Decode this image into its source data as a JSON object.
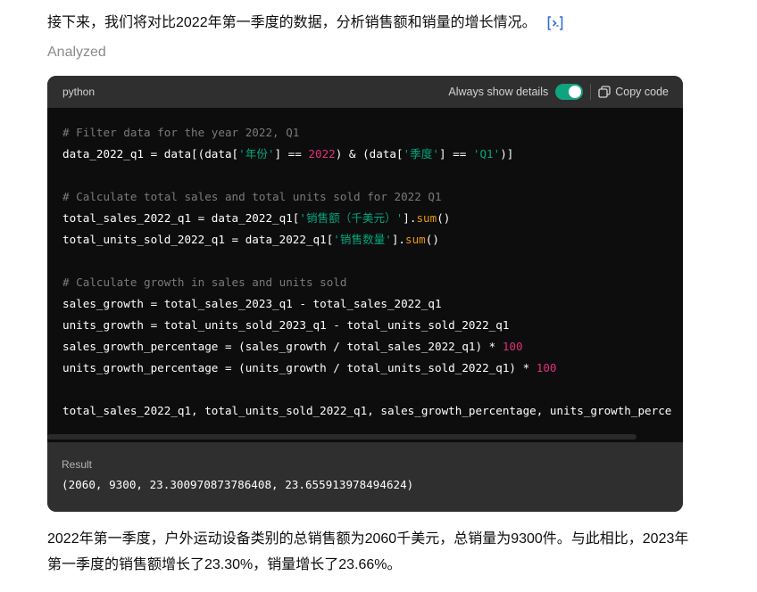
{
  "intro_text": "接下来，我们将对比2022年第一季度的数据，分析销售额和销量的增长情况。",
  "intro_icon": "code-interpreter-icon",
  "analyzed_label": "Analyzed",
  "code_block": {
    "language": "python",
    "toggle_label": "Always show details",
    "toggle_on": true,
    "copy_label": "Copy code",
    "lines": [
      [
        {
          "t": "# Filter data for the year 2022, Q1",
          "c": "cm"
        }
      ],
      [
        {
          "t": "data_2022_q1 = data[(data[",
          "c": ""
        },
        {
          "t": "'年份'",
          "c": "st"
        },
        {
          "t": "] == ",
          "c": ""
        },
        {
          "t": "2022",
          "c": "nu"
        },
        {
          "t": ") & (data[",
          "c": ""
        },
        {
          "t": "'季度'",
          "c": "st"
        },
        {
          "t": "] == ",
          "c": ""
        },
        {
          "t": "'Q1'",
          "c": "st"
        },
        {
          "t": ")]",
          "c": ""
        }
      ],
      [],
      [
        {
          "t": "# Calculate total sales and total units sold for 2022 Q1",
          "c": "cm"
        }
      ],
      [
        {
          "t": "total_sales_2022_q1 = data_2022_q1[",
          "c": ""
        },
        {
          "t": "'销售额（千美元）'",
          "c": "st"
        },
        {
          "t": "].",
          "c": ""
        },
        {
          "t": "sum",
          "c": "fn"
        },
        {
          "t": "()",
          "c": ""
        }
      ],
      [
        {
          "t": "total_units_sold_2022_q1 = data_2022_q1[",
          "c": ""
        },
        {
          "t": "'销售数量'",
          "c": "st"
        },
        {
          "t": "].",
          "c": ""
        },
        {
          "t": "sum",
          "c": "fn"
        },
        {
          "t": "()",
          "c": ""
        }
      ],
      [],
      [
        {
          "t": "# Calculate growth in sales and units sold",
          "c": "cm"
        }
      ],
      [
        {
          "t": "sales_growth = total_sales_2023_q1 - total_sales_2022_q1",
          "c": ""
        }
      ],
      [
        {
          "t": "units_growth = total_units_sold_2023_q1 - total_units_sold_2022_q1",
          "c": ""
        }
      ],
      [
        {
          "t": "sales_growth_percentage = (sales_growth / total_sales_2022_q1) * ",
          "c": ""
        },
        {
          "t": "100",
          "c": "nu"
        }
      ],
      [
        {
          "t": "units_growth_percentage = (units_growth / total_units_sold_2022_q1) * ",
          "c": ""
        },
        {
          "t": "100",
          "c": "nu"
        }
      ],
      [],
      [
        {
          "t": "total_sales_2022_q1, total_units_sold_2022_q1, sales_growth_percentage, units_growth_perce",
          "c": ""
        }
      ]
    ],
    "result_title": "Result",
    "result_value": "(2060, 9300, 23.300970873786408, 23.655913978494624)"
  },
  "summary_text": "2022年第一季度，户外运动设备类别的总销售额为2060千美元，总销量为9300件。与此相比，2023年第一季度的销售额增长了23.30%，销量增长了23.66%。",
  "colors": {
    "code_bg": "#0d0d0d",
    "header_bg": "#2f2f2f",
    "comment": "#7a7a7a",
    "string": "#00a67d",
    "number": "#df3079",
    "function": "#e9950c",
    "toggle": "#10a37f",
    "link_icon": "#2e6fd8"
  }
}
